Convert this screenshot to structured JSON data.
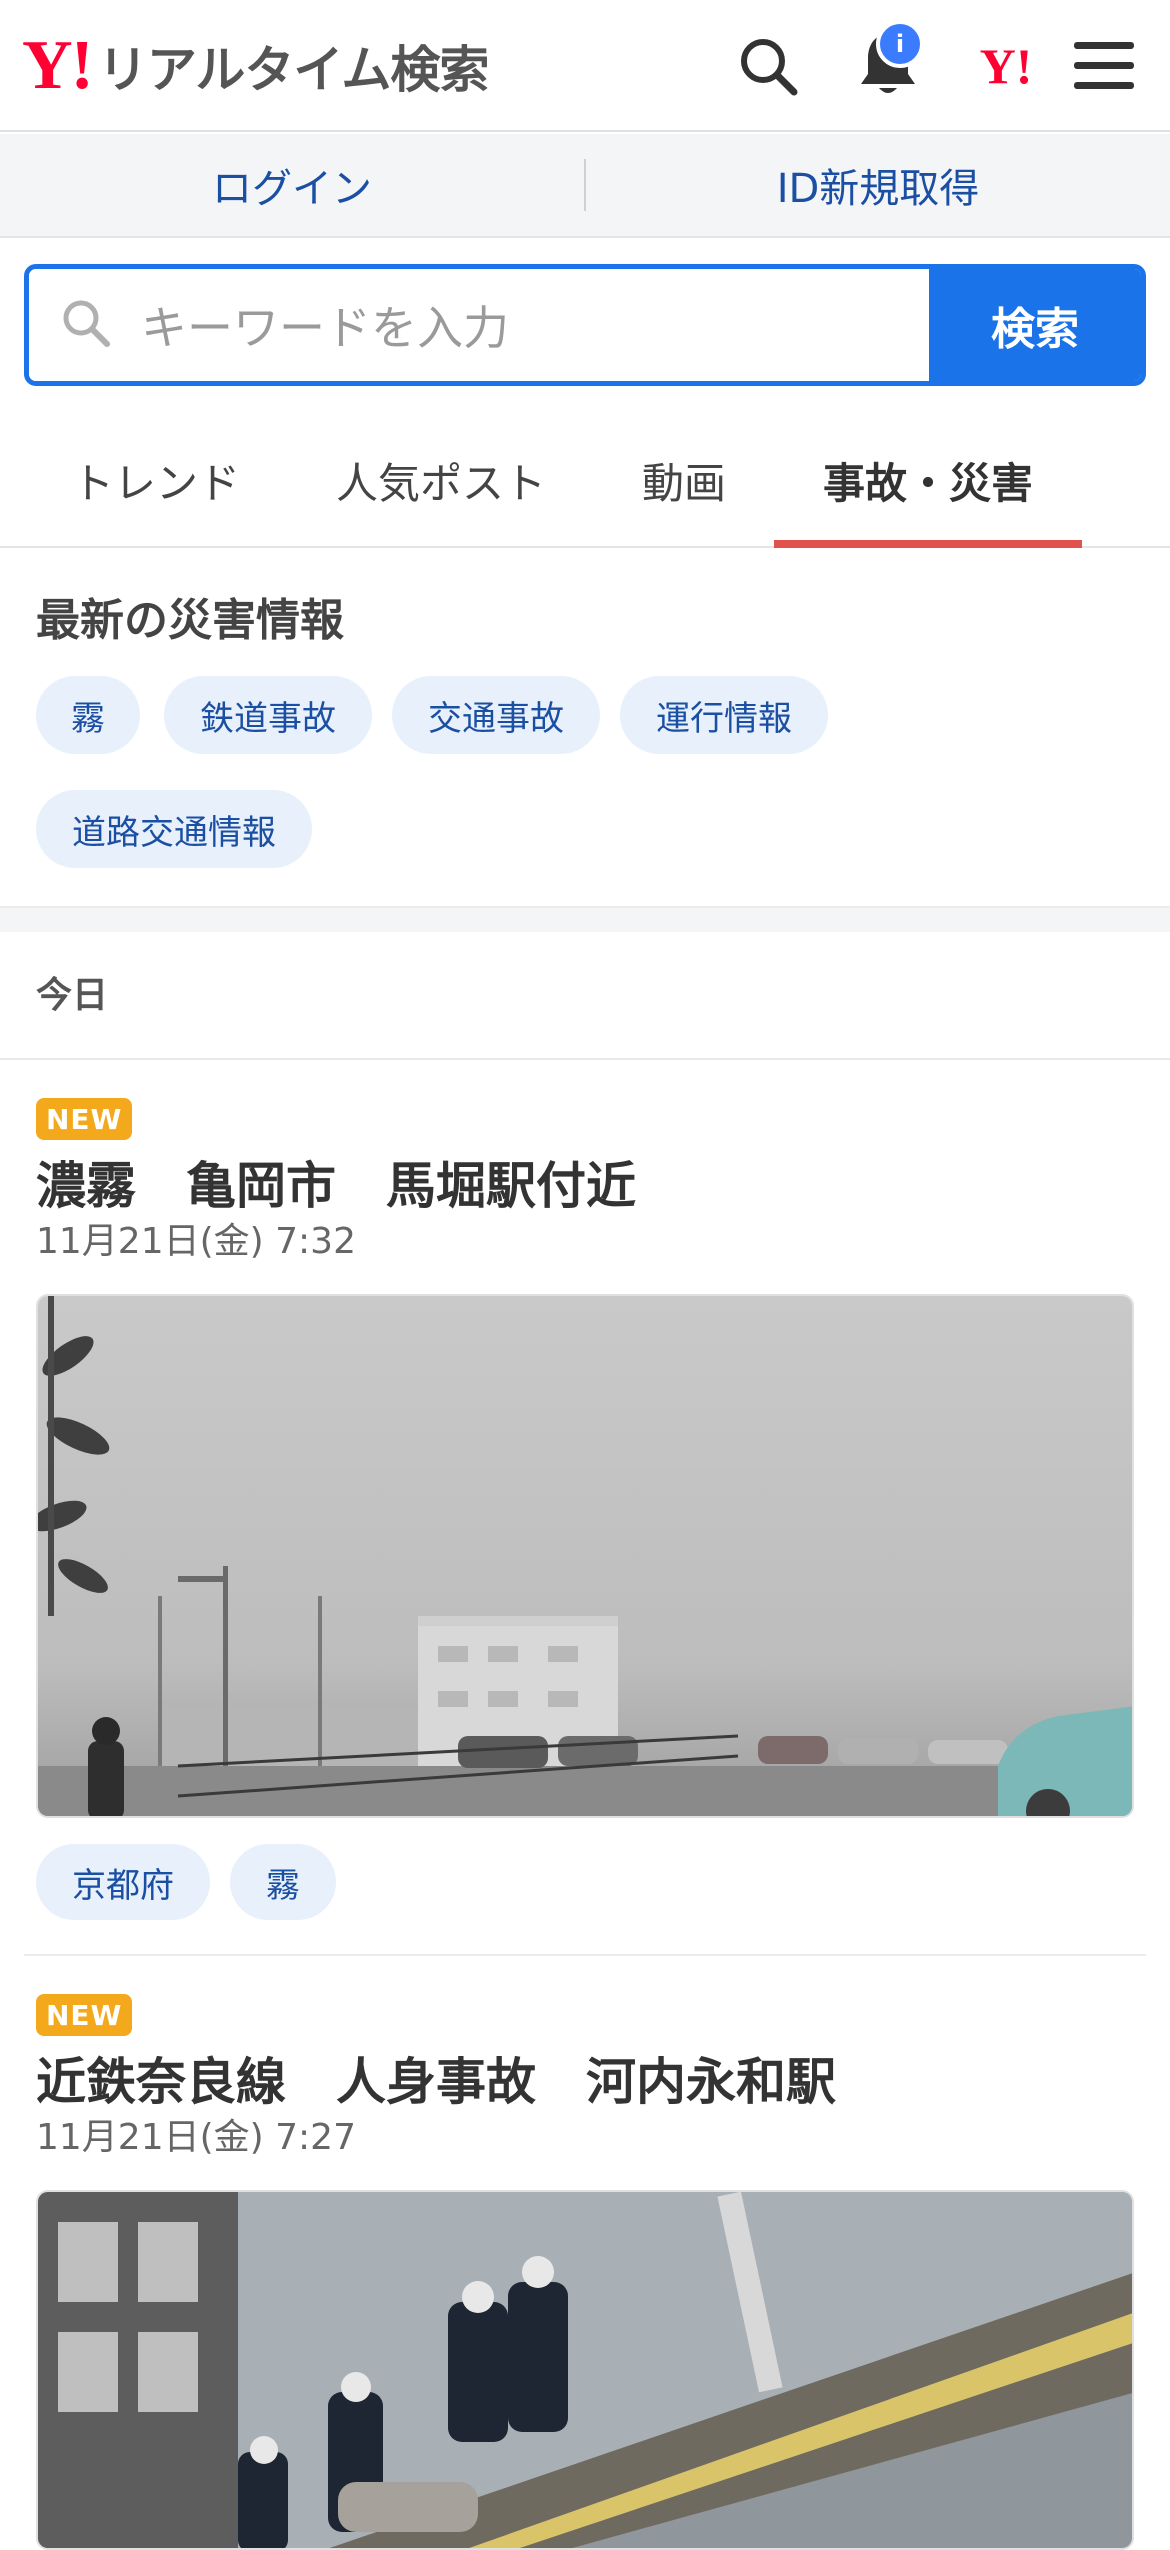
{
  "header": {
    "logo_mark": "Y!",
    "logo_text": "リアルタイム検索",
    "notification_badge": "i",
    "yahoo_icon": "Y!",
    "icons": [
      "search-icon",
      "bell-icon",
      "yahoo-icon",
      "menu-icon"
    ]
  },
  "account": {
    "login": "ログイン",
    "register": "ID新規取得"
  },
  "search": {
    "placeholder": "キーワードを入力",
    "button": "検索"
  },
  "tabs": [
    {
      "label": "トレンド"
    },
    {
      "label": "人気ポスト"
    },
    {
      "label": "動画"
    },
    {
      "label": "事故・災害",
      "active": true
    }
  ],
  "disaster": {
    "title": "最新の災害情報",
    "chips": [
      "霧",
      "鉄道事故",
      "交通事故",
      "運行情報",
      "道路交通情報"
    ]
  },
  "feed": {
    "date_label": "今日",
    "posts": [
      {
        "badge": "NEW",
        "title": "濃霧　亀岡市　馬堀駅付近",
        "time": "11月21日(金) 7:32",
        "tags": [
          "京都府",
          "霧"
        ]
      },
      {
        "badge": "NEW",
        "title": "近鉄奈良線　人身事故　河内永和駅",
        "time": "11月21日(金) 7:27",
        "tags": []
      }
    ]
  },
  "colors": {
    "brand_red": "#ff0033",
    "accent_blue": "#1a73e8",
    "link_blue": "#1a4fa3",
    "tab_underline": "#e0524a",
    "new_badge": "#f4a91c",
    "chip_bg": "#e8f0fb"
  }
}
